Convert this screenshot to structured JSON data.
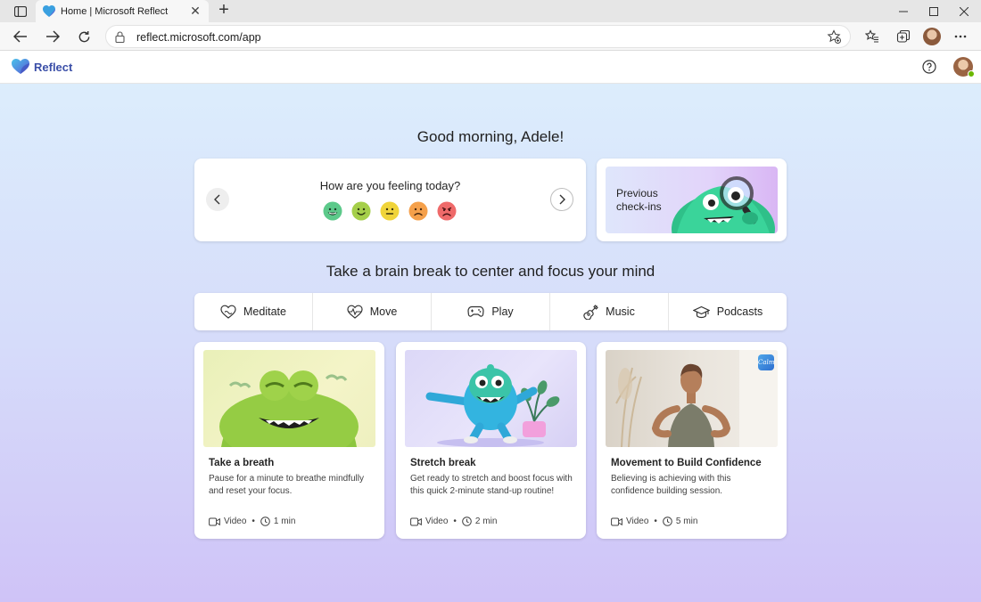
{
  "browser": {
    "tab_title": "Home | Microsoft Reflect",
    "url": "reflect.microsoft.com/app"
  },
  "app": {
    "brand": "Reflect",
    "accent": "#3b4fa8"
  },
  "greeting": "Good morning, Adele!",
  "checkin": {
    "question": "How are you feeling today?",
    "emotions": [
      {
        "icon": "very-happy-face-icon",
        "color": "#5cc98a"
      },
      {
        "icon": "happy-face-icon",
        "color": "#a5cf4a"
      },
      {
        "icon": "neutral-face-icon",
        "color": "#f0d43a"
      },
      {
        "icon": "sad-face-icon",
        "color": "#f5a04a"
      },
      {
        "icon": "upset-face-icon",
        "color": "#ef6a6a"
      }
    ]
  },
  "previous": {
    "line1": "Previous",
    "line2": "check-ins"
  },
  "brain_break": {
    "heading": "Take a brain break to center and focus your mind",
    "categories": [
      "Meditate",
      "Move",
      "Play",
      "Music",
      "Podcasts"
    ]
  },
  "activities": [
    {
      "title": "Take a breath",
      "description": "Pause for a minute to breathe mindfully and reset your focus.",
      "type": "Video",
      "duration": "1 min"
    },
    {
      "title": "Stretch break",
      "description": "Get ready to stretch and boost focus with this quick 2-minute stand-up routine!",
      "type": "Video",
      "duration": "2 min"
    },
    {
      "title": "Movement to Build Confidence",
      "description": "Believing is achieving with this confidence building session.",
      "type": "Video",
      "duration": "5 min",
      "badge": "Calm"
    }
  ]
}
